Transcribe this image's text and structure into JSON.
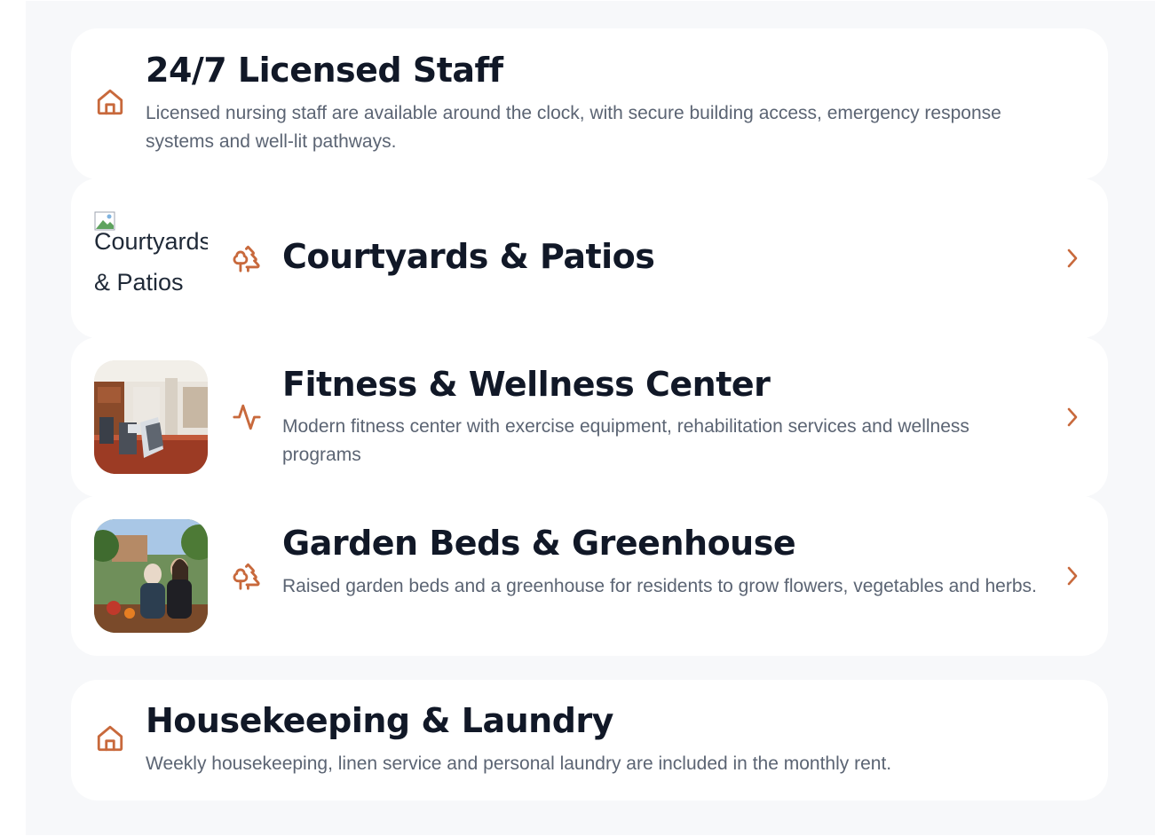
{
  "colors": {
    "accent": "#c8693c",
    "title": "#111827",
    "description": "#5b6473",
    "panel_background": "#f7f8fa",
    "card_background": "#ffffff"
  },
  "cards": [
    {
      "title": "24/7 Licensed Staff",
      "description": "Licensed nursing staff are available around the clock, with secure building access, emergency response systems and well-lit pathways.",
      "icon": "home-icon"
    },
    {
      "title": "Courtyards & Patios",
      "image_alt": "Courtyards & Patios",
      "icon": "trees-icon",
      "action_icon": "chevron-right-icon"
    },
    {
      "title": "Fitness & Wellness Center",
      "description": "Modern fitness center with exercise equipment, rehabilitation services and wellness programs",
      "icon": "activity-icon",
      "image": "fitness-room-photo",
      "action_icon": "chevron-right-icon"
    },
    {
      "title": "Garden Beds & Greenhouse",
      "description": "Raised garden beds and a greenhouse for residents to grow flowers, vegetables and herbs.",
      "icon": "trees-icon",
      "image": "garden-residents-photo",
      "action_icon": "chevron-right-icon"
    },
    {
      "title": "Housekeeping & Laundry",
      "description": "Weekly housekeeping, linen service and personal laundry are included in the monthly rent.",
      "icon": "home-icon"
    }
  ]
}
